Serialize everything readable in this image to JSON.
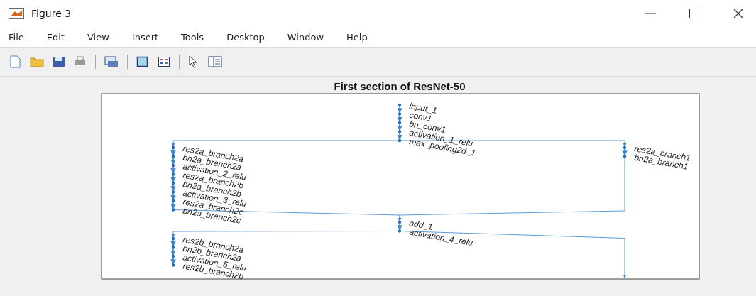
{
  "window": {
    "title": "Figure 3"
  },
  "menu": [
    "File",
    "Edit",
    "View",
    "Insert",
    "Tools",
    "Desktop",
    "Window",
    "Help"
  ],
  "plot": {
    "title": "First section of ResNet-50",
    "node_groups": [
      {
        "labels": [
          "input_1",
          "conv1",
          "bn_conv1",
          "activation_1_relu",
          "max_pooling2d_1"
        ]
      },
      {
        "labels": [
          "res2a_branch2a",
          "bn2a_branch2a",
          "activation_2_relu",
          "res2a_branch2b",
          "bn2a_branch2b",
          "activation_3_relu",
          "res2a_branch2c",
          "bn2a_branch2c"
        ]
      },
      {
        "labels": [
          "res2a_branch1",
          "bn2a_branch1"
        ]
      },
      {
        "labels": [
          "add_1",
          "activation_4_relu"
        ]
      },
      {
        "labels": [
          "res2b_branch2a",
          "bn2b_branch2a",
          "activation_5_relu",
          "res2b_branch2b"
        ]
      }
    ]
  }
}
